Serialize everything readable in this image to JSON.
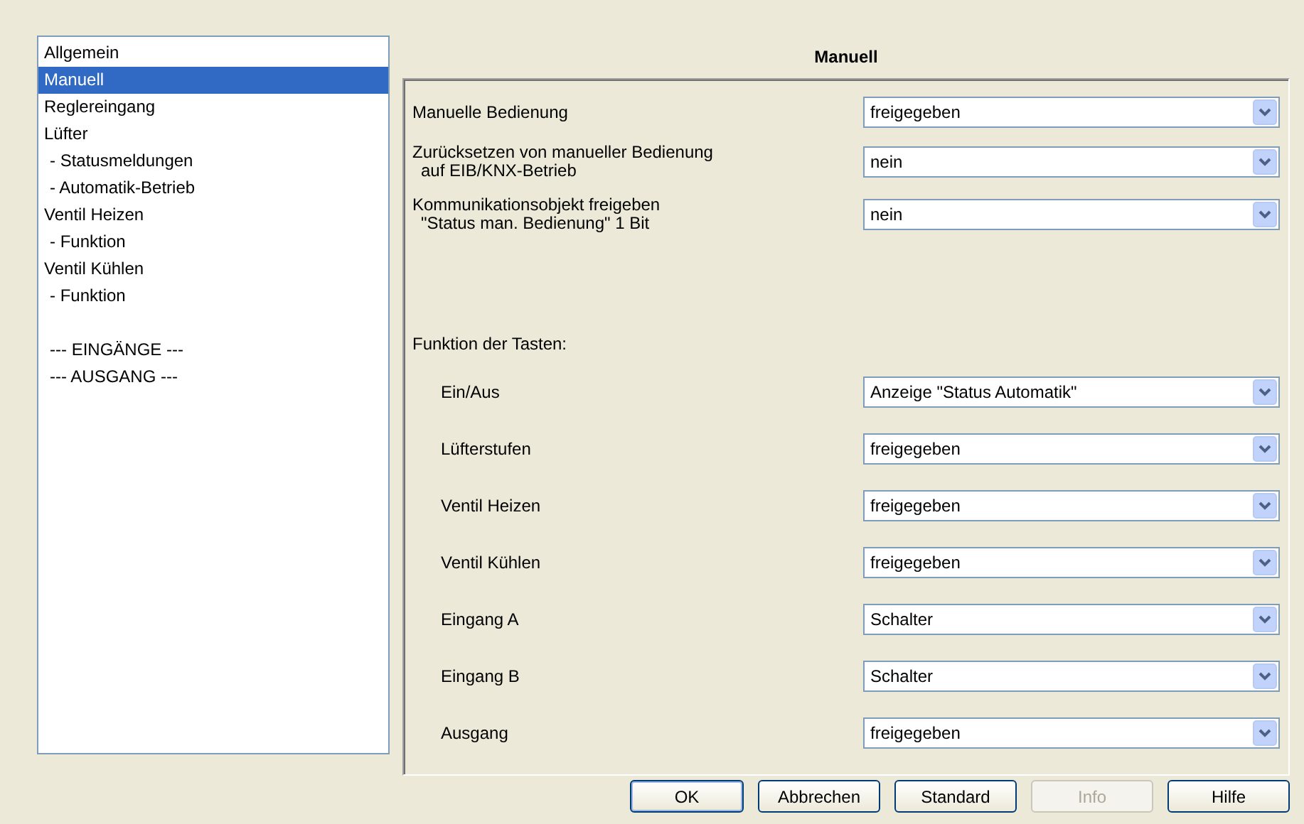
{
  "sidebar": {
    "items": [
      {
        "label": "Allgemein",
        "selected": false,
        "kind": "page"
      },
      {
        "label": "Manuell",
        "selected": true,
        "kind": "page"
      },
      {
        "label": "Reglereingang",
        "selected": false,
        "kind": "page"
      },
      {
        "label": "Lüfter",
        "selected": false,
        "kind": "page",
        "children": [
          {
            "label": "- Statusmeldungen",
            "selected": false
          },
          {
            "label": "- Automatik-Betrieb",
            "selected": false
          }
        ]
      },
      {
        "label": "Ventil Heizen",
        "selected": false,
        "kind": "page",
        "children": [
          {
            "label": "- Funktion",
            "selected": false
          }
        ]
      },
      {
        "label": "Ventil Kühlen",
        "selected": false,
        "kind": "page",
        "children": [
          {
            "label": "- Funktion",
            "selected": false
          }
        ]
      },
      {
        "label": "--- EINGÄNGE ---",
        "selected": false,
        "kind": "section"
      },
      {
        "label": "--- AUSGANG ---",
        "selected": false,
        "kind": "section"
      }
    ]
  },
  "page": {
    "title": "Manuell",
    "settings": [
      {
        "lines": [
          "Manuelle Bedienung"
        ],
        "value": "freigegeben"
      },
      {
        "lines": [
          "Zurücksetzen von manueller Bedienung",
          "auf EIB/KNX-Betrieb"
        ],
        "value": "nein"
      },
      {
        "lines": [
          "Kommunikationsobjekt freigeben",
          "\"Status man. Bedienung\" 1 Bit"
        ],
        "value": "nein"
      }
    ],
    "group_heading": "Funktion der Tasten:",
    "keys": [
      {
        "label": "Ein/Aus",
        "value": "Anzeige \"Status Automatik\""
      },
      {
        "label": "Lüfterstufen",
        "value": "freigegeben"
      },
      {
        "label": "Ventil Heizen",
        "value": "freigegeben"
      },
      {
        "label": "Ventil Kühlen",
        "value": "freigegeben"
      },
      {
        "label": "Eingang A",
        "value": "Schalter"
      },
      {
        "label": "Eingang B",
        "value": "Schalter"
      },
      {
        "label": "Ausgang",
        "value": "freigegeben"
      }
    ]
  },
  "buttons": [
    {
      "label": "OK",
      "disabled": false,
      "default": true
    },
    {
      "label": "Abbrechen",
      "disabled": false,
      "default": false
    },
    {
      "label": "Standard",
      "disabled": false,
      "default": false
    },
    {
      "label": "Info",
      "disabled": true,
      "default": false
    },
    {
      "label": "Hilfe",
      "disabled": false,
      "default": false
    }
  ]
}
